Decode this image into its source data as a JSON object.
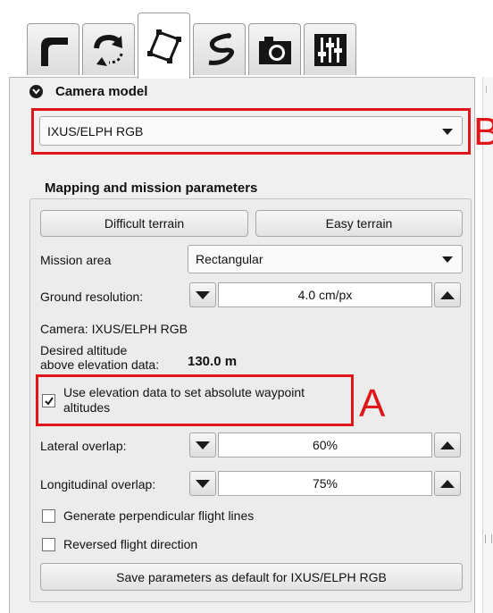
{
  "tabs": [
    {
      "icon": "takeoff-icon"
    },
    {
      "icon": "sync-icon"
    },
    {
      "icon": "polygon-mission-icon",
      "active": true
    },
    {
      "icon": "flight-path-icon"
    },
    {
      "icon": "camera-icon"
    },
    {
      "icon": "sliders-icon"
    }
  ],
  "camera_model": {
    "title": "Camera model",
    "selected": "IXUS/ELPH RGB"
  },
  "mapping": {
    "title": "Mapping and mission parameters",
    "difficult_terrain_label": "Difficult terrain",
    "easy_terrain_label": "Easy terrain",
    "mission_area_label": "Mission area",
    "mission_area_value": "Rectangular",
    "ground_resolution_label": "Ground resolution:",
    "ground_resolution_value": "4.0 cm/px",
    "camera_info": "Camera: IXUS/ELPH RGB",
    "desired_altitude_label_line1": "Desired altitude",
    "desired_altitude_label_line2": "above elevation data:",
    "desired_altitude_value": "130.0 m",
    "use_elevation_label_line1": "Use elevation data to set absolute waypoint",
    "use_elevation_label_line2": "altitudes",
    "use_elevation_checked": true,
    "lateral_overlap_label": "Lateral overlap:",
    "lateral_overlap_value": "60%",
    "longitudinal_overlap_label": "Longitudinal overlap:",
    "longitudinal_overlap_value": "75%",
    "perpendicular_lines_label": "Generate perpendicular flight lines",
    "perpendicular_lines_checked": false,
    "reversed_direction_label": "Reversed flight direction",
    "reversed_direction_checked": false,
    "save_default_label": "Save parameters as default for IXUS/ELPH RGB"
  },
  "annotations": {
    "a_letter": "A",
    "b_letter": "B",
    "color": "#e0171a"
  },
  "colors": {
    "panel_bg": "#f0f0f0",
    "group_bg": "#ececec"
  }
}
